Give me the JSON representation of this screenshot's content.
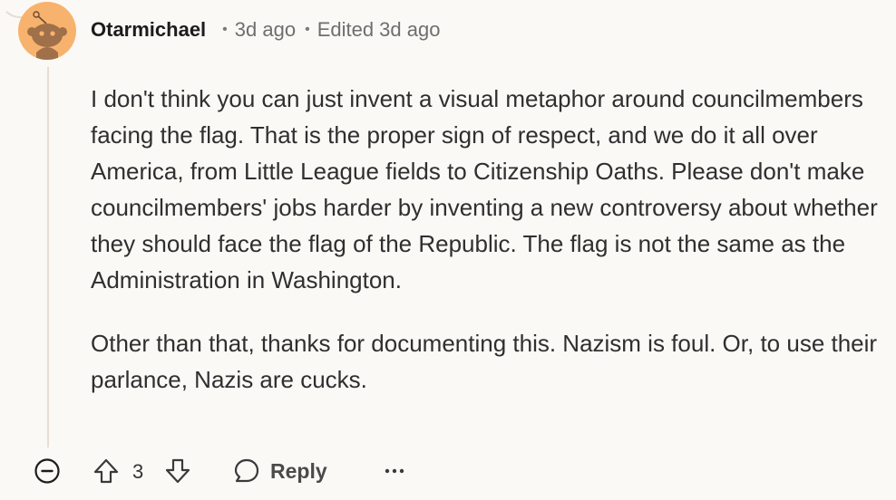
{
  "comment": {
    "author": "Otarmichael",
    "posted": "3d ago",
    "edited": "Edited 3d ago",
    "paragraphs": [
      "I don't think you can just invent a visual metaphor around councilmembers facing the flag. That is the proper sign of respect, and we do it all over America, from Little League fields to Citizenship Oaths. Please don't make councilmembers' jobs harder by inventing a new controversy about whether they should face the flag of the Republic. The flag is not the same as the Administration in Washington.",
      "Other than that, thanks for documenting this. Nazism is foul. Or, to use their parlance, Nazis are cucks."
    ]
  },
  "actions": {
    "score": "3",
    "reply_label": "Reply",
    "more_label": "···"
  },
  "colors": {
    "background": "#fbf9f6",
    "avatar": "#f7b36d",
    "thread_line": "#e6ddd1"
  },
  "icons": {
    "collapse": "minus-circle-icon",
    "upvote": "arrow-up-icon",
    "downvote": "arrow-down-icon",
    "reply": "speech-bubble-icon",
    "more": "ellipsis-icon"
  }
}
